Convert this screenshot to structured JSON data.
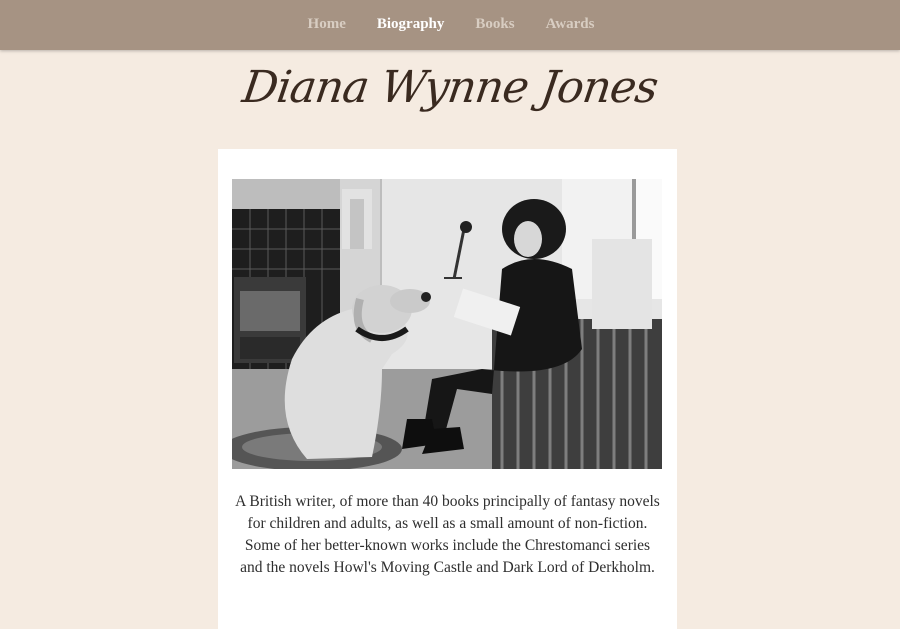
{
  "nav": {
    "items": [
      {
        "label": "Home"
      },
      {
        "label": "Biography"
      },
      {
        "label": "Books"
      },
      {
        "label": "Awards"
      }
    ],
    "active_index": 1
  },
  "page": {
    "title": "Diana Wynne Jones"
  },
  "main": {
    "bio": "A British writer, of more than 40 books principally of fantasy novels for children and adults, as well as a small amount of non-fiction. Some of her better-known works include the Chrestomanci series and the novels Howl's Moving Castle and Dark Lord of Derkholm."
  },
  "colors": {
    "nav_bg": "#a69383",
    "page_bg": "#f5ebe1",
    "card_bg": "#ffffff",
    "title_text": "#3a2a20",
    "nav_active": "#ffffff",
    "nav_inactive": "#d8cdc2"
  }
}
